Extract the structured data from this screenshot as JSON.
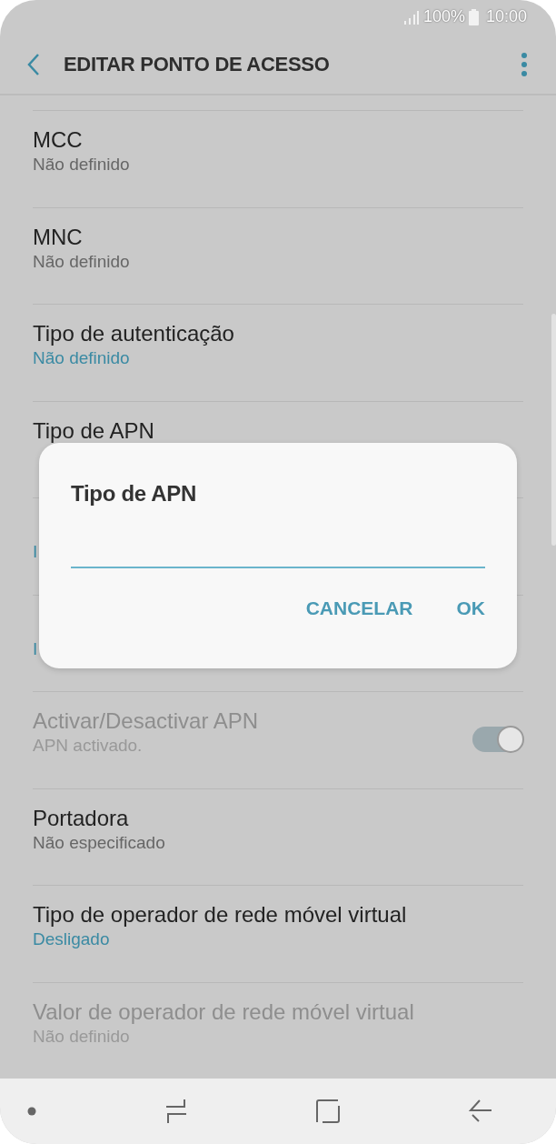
{
  "status_bar": {
    "battery": "100%",
    "time": "10:00"
  },
  "header": {
    "title": "EDITAR PONTO DE ACESSO"
  },
  "settings": [
    {
      "title": "MCC",
      "value": "Não definido",
      "accent": false,
      "disabled": false
    },
    {
      "title": "MNC",
      "value": "Não definido",
      "accent": false,
      "disabled": false
    },
    {
      "title": "Tipo de autenticação",
      "value": "Não definido",
      "accent": true,
      "disabled": false
    },
    {
      "title": "Tipo de APN",
      "disabled": false
    },
    {
      "value": "I",
      "accent": true,
      "disabled": false
    },
    {
      "value": "I",
      "accent": true,
      "disabled": false
    },
    {
      "title": "Activar/Desactivar APN",
      "value": "APN activado.",
      "accent": false,
      "disabled": true,
      "switch": {
        "on": true
      }
    },
    {
      "title": "Portadora",
      "value": "Não especificado",
      "accent": false,
      "disabled": false
    },
    {
      "title": "Tipo de operador de rede móvel virtual",
      "value": "Desligado",
      "accent": true,
      "disabled": false
    },
    {
      "title": "Valor de operador de rede móvel virtual",
      "value": "Não definido",
      "accent": false,
      "disabled": true
    }
  ],
  "dialog": {
    "title": "Tipo de APN",
    "buttons": [
      "CANCELAR",
      "OK"
    ]
  }
}
